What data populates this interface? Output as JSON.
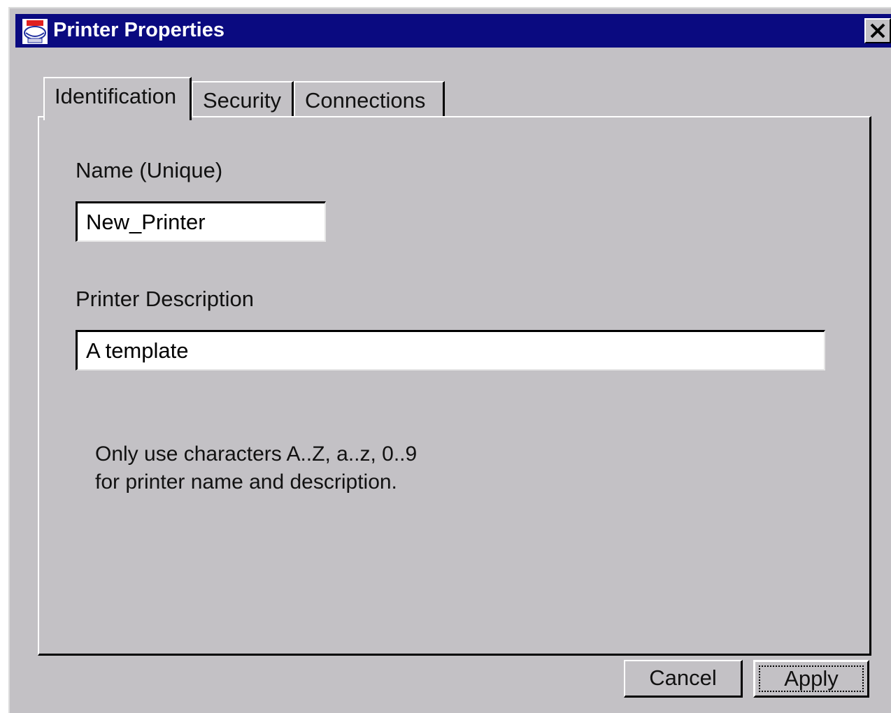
{
  "window": {
    "title": "Printer Properties",
    "title_icon": "printer-icon",
    "close_icon": "close-x-icon",
    "colors": {
      "titlebar": "#0a0a80",
      "face": "#c3c1c5"
    }
  },
  "tabs": [
    {
      "label": "Identification",
      "active": true
    },
    {
      "label": "Security",
      "active": false
    },
    {
      "label": "Connections",
      "active": false
    }
  ],
  "form": {
    "name_label": "Name (Unique)",
    "name_value": "New_Printer",
    "description_label": "Printer Description",
    "description_value": "A template",
    "hint_line1": "Only use characters A..Z, a..z, 0..9",
    "hint_line2": "for printer name and description."
  },
  "buttons": {
    "cancel_label": "Cancel",
    "apply_label": "Apply"
  }
}
